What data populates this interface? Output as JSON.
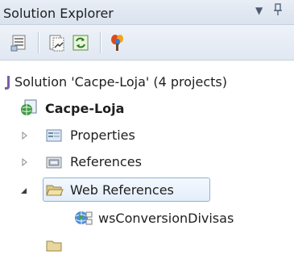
{
  "panel": {
    "title": "Solution Explorer",
    "pin_glyph": "ا",
    "dropdown_glyph": "▼"
  },
  "toolbar": {
    "buttons": [
      {
        "icon": "properties-icon"
      },
      {
        "icon": "show-all-files-icon"
      },
      {
        "icon": "refresh-icon"
      },
      {
        "icon": "view-class-diagram-icon"
      }
    ]
  },
  "tree": {
    "solution_label": "Solution 'Cacpe-Loja' (4 projects)",
    "project_label": "Cacpe-Loja",
    "items": [
      {
        "label": "Properties",
        "expanded": false
      },
      {
        "label": "References",
        "expanded": false
      },
      {
        "label": "Web References",
        "expanded": true,
        "selected": true
      }
    ],
    "web_reference_child": "wsConversionDivisas"
  },
  "colors": {
    "selection_border": "#8fb2d8",
    "selection_fill": "#e3eefa",
    "header_bg": "#e9eef6"
  }
}
